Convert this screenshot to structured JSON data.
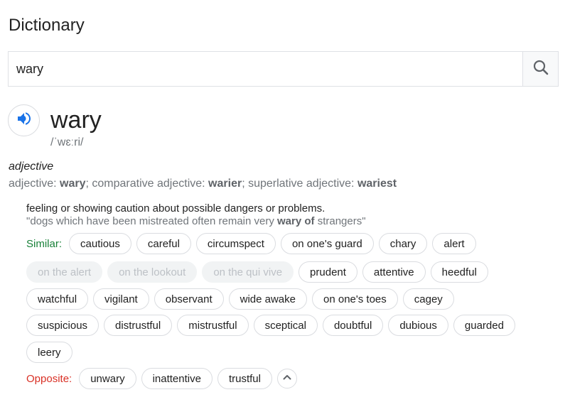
{
  "page_title": "Dictionary",
  "search": {
    "value": "wary",
    "placeholder": ""
  },
  "entry": {
    "word": "wary",
    "phonetic": "/ˈwɛːri/",
    "part_of_speech": "adjective",
    "forms": {
      "prefix": "adjective: ",
      "base": "wary",
      "comparative_label": "; comparative adjective: ",
      "comparative": "warier",
      "superlative_label": "; superlative adjective: ",
      "superlative": "wariest"
    },
    "definition": "feeling or showing caution about possible dangers or problems.",
    "example": {
      "before": "\"dogs which have been mistreated often remain very ",
      "bold": "wary of",
      "after": " strangers\""
    }
  },
  "similar": {
    "label": "Similar:",
    "rows": [
      [
        {
          "text": "cautious",
          "disabled": false
        },
        {
          "text": "careful",
          "disabled": false
        },
        {
          "text": "circumspect",
          "disabled": false
        },
        {
          "text": "on one's guard",
          "disabled": false
        },
        {
          "text": "chary",
          "disabled": false
        },
        {
          "text": "alert",
          "disabled": false
        }
      ],
      [
        {
          "text": "on the alert",
          "disabled": true
        },
        {
          "text": "on the lookout",
          "disabled": true
        },
        {
          "text": "on the qui vive",
          "disabled": true
        },
        {
          "text": "prudent",
          "disabled": false
        },
        {
          "text": "attentive",
          "disabled": false
        },
        {
          "text": "heedful",
          "disabled": false
        }
      ],
      [
        {
          "text": "watchful",
          "disabled": false
        },
        {
          "text": "vigilant",
          "disabled": false
        },
        {
          "text": "observant",
          "disabled": false
        },
        {
          "text": "wide awake",
          "disabled": false
        },
        {
          "text": "on one's toes",
          "disabled": false
        },
        {
          "text": "cagey",
          "disabled": false
        }
      ],
      [
        {
          "text": "suspicious",
          "disabled": false
        },
        {
          "text": "distrustful",
          "disabled": false
        },
        {
          "text": "mistrustful",
          "disabled": false
        },
        {
          "text": "sceptical",
          "disabled": false
        },
        {
          "text": "doubtful",
          "disabled": false
        },
        {
          "text": "dubious",
          "disabled": false
        },
        {
          "text": "guarded",
          "disabled": false
        }
      ],
      [
        {
          "text": "leery",
          "disabled": false
        }
      ]
    ]
  },
  "opposite": {
    "label": "Opposite:",
    "items": [
      "unwary",
      "inattentive",
      "trustful"
    ]
  },
  "icons": {
    "search": "search-icon",
    "speaker": "speaker-icon",
    "collapse": "chevron-up-icon"
  },
  "colors": {
    "similar_label": "#188038",
    "opposite_label": "#d93025",
    "speaker_blue": "#1a73e8"
  }
}
